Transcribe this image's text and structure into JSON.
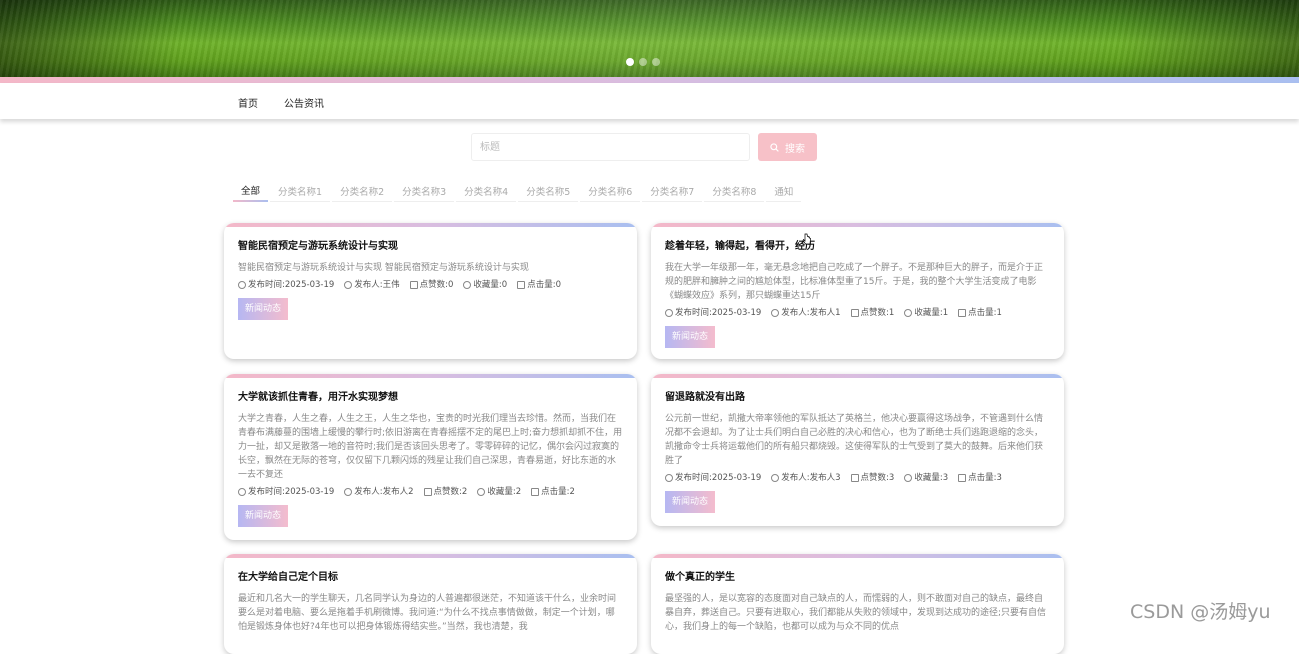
{
  "nav": {
    "items": [
      "首页",
      "公告资讯"
    ]
  },
  "search": {
    "placeholder": "标题",
    "button_label": "搜索"
  },
  "tabs": [
    "全部",
    "分类名称1",
    "分类名称2",
    "分类名称3",
    "分类名称4",
    "分类名称5",
    "分类名称6",
    "分类名称7",
    "分类名称8",
    "通知"
  ],
  "carousel": {
    "slide_count": 3,
    "active_index": 0
  },
  "cards": [
    {
      "title": "智能民宿预定与游玩系统设计与实现",
      "summary": "智能民宿预定与游玩系统设计与实现 智能民宿预定与游玩系统设计与实现",
      "time": "发布时间:2025-03-19",
      "author": "发布人:王伟",
      "likes": "点赞数:0",
      "favorites": "收藏量:0",
      "clicks": "点击量:0",
      "tag": "新闻动态"
    },
    {
      "title": "趁着年轻，输得起，看得开，经历",
      "summary": "我在大学一年级那一年，毫无悬念地把自己吃成了一个胖子。不是那种巨大的胖子，而是介于正规的肥胖和臃肿之间的尴尬体型，比标准体型重了15斤。于是，我的整个大学生活变成了电影《蝴蝶效应》系列，那只蝴蝶重达15斤",
      "time": "发布时间:2025-03-19",
      "author": "发布人:发布人1",
      "likes": "点赞数:1",
      "favorites": "收藏量:1",
      "clicks": "点击量:1",
      "tag": "新闻动态"
    },
    {
      "title": "大学就该抓住青春，用汗水实现梦想",
      "summary": "大学之青春，人生之春，人生之王，人生之华也，宝贵的时光我们理当去珍惜。然而，当我们在青春布满藤蔓的围墙上缓慢的攀行时;依旧游离在青春摇摆不定的尾巴上时;奋力想抓却抓不住，用力一扯，却又是散落一地的音符时;我们是否该回头思考了。零零碎碎的记忆，偶尔会闪过寂寞的长空，飘然在无际的苍穹，仅仅留下几颗闪烁的残星让我们自己深思，青春易逝，好比东逝的水一去不复还",
      "time": "发布时间:2025-03-19",
      "author": "发布人:发布人2",
      "likes": "点赞数:2",
      "favorites": "收藏量:2",
      "clicks": "点击量:2",
      "tag": "新闻动态"
    },
    {
      "title": "留退路就没有出路",
      "summary": "公元前一世纪，凯撒大帝率领他的军队抵达了英格兰，他决心要赢得这场战争，不管遇到什么情况都不会退却。为了让士兵们明白自己必胜的决心和信心，也为了断绝士兵们逃跑退缩的念头，凯撒命令士兵将运载他们的所有船只都烧毁。这使得军队的士气受到了莫大的鼓舞。后来他们获胜了",
      "time": "发布时间:2025-03-19",
      "author": "发布人:发布人3",
      "likes": "点赞数:3",
      "favorites": "收藏量:3",
      "clicks": "点击量:3",
      "tag": "新闻动态"
    },
    {
      "title": "在大学给自己定个目标",
      "summary": "最近和几名大一的学生聊天，几名同学认为身边的人普遍都很迷茫，不知道该干什么，业余时间要么是对着电脑、要么是拖着手机刷微博。我问道:“为什么不找点事情做做，制定一个计划，哪怕是锻炼身体也好?4年也可以把身体锻炼得结实些。”当然，我也清楚，我",
      "time": "",
      "author": "",
      "likes": "",
      "favorites": "",
      "clicks": "",
      "tag": ""
    },
    {
      "title": "做个真正的学生",
      "summary": "最坚强的人，是以宽容的态度面对自己缺点的人，而懦弱的人，则不敢面对自己的缺点，最终自暴自弃，葬送自己。只要有进取心，我们都能从失败的领域中，发现到达成功的途径;只要有自信心，我们身上的每一个缺陷，也都可以成为与众不同的优点",
      "time": "",
      "author": "",
      "likes": "",
      "favorites": "",
      "clicks": "",
      "tag": ""
    }
  ],
  "watermark": "CSDN @汤姆yu",
  "colors": {
    "accent_pink": "#f4b8c8",
    "accent_blue": "#a9bff0",
    "search_button": "#f7c1c8"
  }
}
